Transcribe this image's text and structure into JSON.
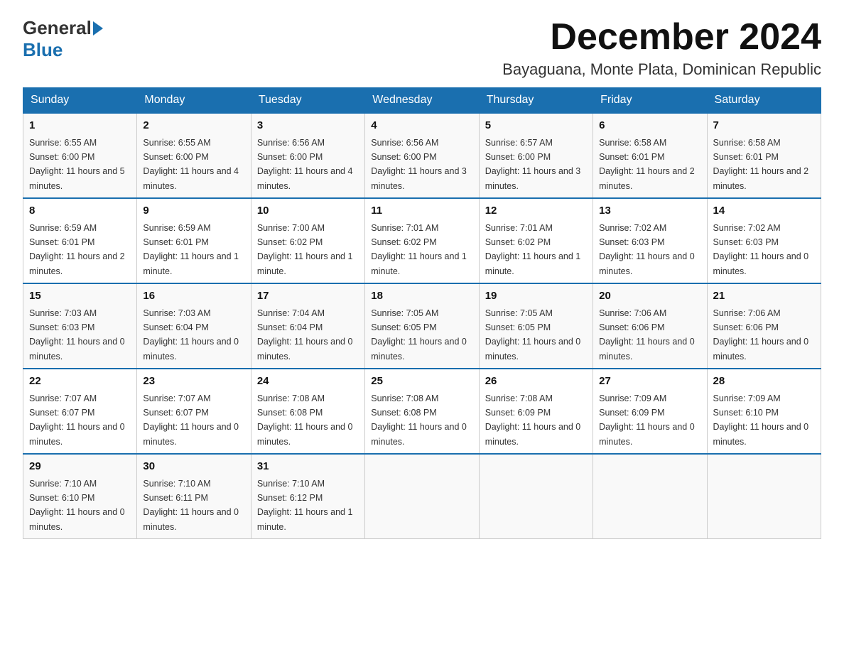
{
  "logo": {
    "general": "General",
    "blue": "Blue"
  },
  "title": {
    "month": "December 2024",
    "location": "Bayaguana, Monte Plata, Dominican Republic"
  },
  "weekdays": [
    "Sunday",
    "Monday",
    "Tuesday",
    "Wednesday",
    "Thursday",
    "Friday",
    "Saturday"
  ],
  "weeks": [
    [
      {
        "day": "1",
        "sunrise": "6:55 AM",
        "sunset": "6:00 PM",
        "daylight": "11 hours and 5 minutes."
      },
      {
        "day": "2",
        "sunrise": "6:55 AM",
        "sunset": "6:00 PM",
        "daylight": "11 hours and 4 minutes."
      },
      {
        "day": "3",
        "sunrise": "6:56 AM",
        "sunset": "6:00 PM",
        "daylight": "11 hours and 4 minutes."
      },
      {
        "day": "4",
        "sunrise": "6:56 AM",
        "sunset": "6:00 PM",
        "daylight": "11 hours and 3 minutes."
      },
      {
        "day": "5",
        "sunrise": "6:57 AM",
        "sunset": "6:00 PM",
        "daylight": "11 hours and 3 minutes."
      },
      {
        "day": "6",
        "sunrise": "6:58 AM",
        "sunset": "6:01 PM",
        "daylight": "11 hours and 2 minutes."
      },
      {
        "day": "7",
        "sunrise": "6:58 AM",
        "sunset": "6:01 PM",
        "daylight": "11 hours and 2 minutes."
      }
    ],
    [
      {
        "day": "8",
        "sunrise": "6:59 AM",
        "sunset": "6:01 PM",
        "daylight": "11 hours and 2 minutes."
      },
      {
        "day": "9",
        "sunrise": "6:59 AM",
        "sunset": "6:01 PM",
        "daylight": "11 hours and 1 minute."
      },
      {
        "day": "10",
        "sunrise": "7:00 AM",
        "sunset": "6:02 PM",
        "daylight": "11 hours and 1 minute."
      },
      {
        "day": "11",
        "sunrise": "7:01 AM",
        "sunset": "6:02 PM",
        "daylight": "11 hours and 1 minute."
      },
      {
        "day": "12",
        "sunrise": "7:01 AM",
        "sunset": "6:02 PM",
        "daylight": "11 hours and 1 minute."
      },
      {
        "day": "13",
        "sunrise": "7:02 AM",
        "sunset": "6:03 PM",
        "daylight": "11 hours and 0 minutes."
      },
      {
        "day": "14",
        "sunrise": "7:02 AM",
        "sunset": "6:03 PM",
        "daylight": "11 hours and 0 minutes."
      }
    ],
    [
      {
        "day": "15",
        "sunrise": "7:03 AM",
        "sunset": "6:03 PM",
        "daylight": "11 hours and 0 minutes."
      },
      {
        "day": "16",
        "sunrise": "7:03 AM",
        "sunset": "6:04 PM",
        "daylight": "11 hours and 0 minutes."
      },
      {
        "day": "17",
        "sunrise": "7:04 AM",
        "sunset": "6:04 PM",
        "daylight": "11 hours and 0 minutes."
      },
      {
        "day": "18",
        "sunrise": "7:05 AM",
        "sunset": "6:05 PM",
        "daylight": "11 hours and 0 minutes."
      },
      {
        "day": "19",
        "sunrise": "7:05 AM",
        "sunset": "6:05 PM",
        "daylight": "11 hours and 0 minutes."
      },
      {
        "day": "20",
        "sunrise": "7:06 AM",
        "sunset": "6:06 PM",
        "daylight": "11 hours and 0 minutes."
      },
      {
        "day": "21",
        "sunrise": "7:06 AM",
        "sunset": "6:06 PM",
        "daylight": "11 hours and 0 minutes."
      }
    ],
    [
      {
        "day": "22",
        "sunrise": "7:07 AM",
        "sunset": "6:07 PM",
        "daylight": "11 hours and 0 minutes."
      },
      {
        "day": "23",
        "sunrise": "7:07 AM",
        "sunset": "6:07 PM",
        "daylight": "11 hours and 0 minutes."
      },
      {
        "day": "24",
        "sunrise": "7:08 AM",
        "sunset": "6:08 PM",
        "daylight": "11 hours and 0 minutes."
      },
      {
        "day": "25",
        "sunrise": "7:08 AM",
        "sunset": "6:08 PM",
        "daylight": "11 hours and 0 minutes."
      },
      {
        "day": "26",
        "sunrise": "7:08 AM",
        "sunset": "6:09 PM",
        "daylight": "11 hours and 0 minutes."
      },
      {
        "day": "27",
        "sunrise": "7:09 AM",
        "sunset": "6:09 PM",
        "daylight": "11 hours and 0 minutes."
      },
      {
        "day": "28",
        "sunrise": "7:09 AM",
        "sunset": "6:10 PM",
        "daylight": "11 hours and 0 minutes."
      }
    ],
    [
      {
        "day": "29",
        "sunrise": "7:10 AM",
        "sunset": "6:10 PM",
        "daylight": "11 hours and 0 minutes."
      },
      {
        "day": "30",
        "sunrise": "7:10 AM",
        "sunset": "6:11 PM",
        "daylight": "11 hours and 0 minutes."
      },
      {
        "day": "31",
        "sunrise": "7:10 AM",
        "sunset": "6:12 PM",
        "daylight": "11 hours and 1 minute."
      },
      null,
      null,
      null,
      null
    ]
  ]
}
